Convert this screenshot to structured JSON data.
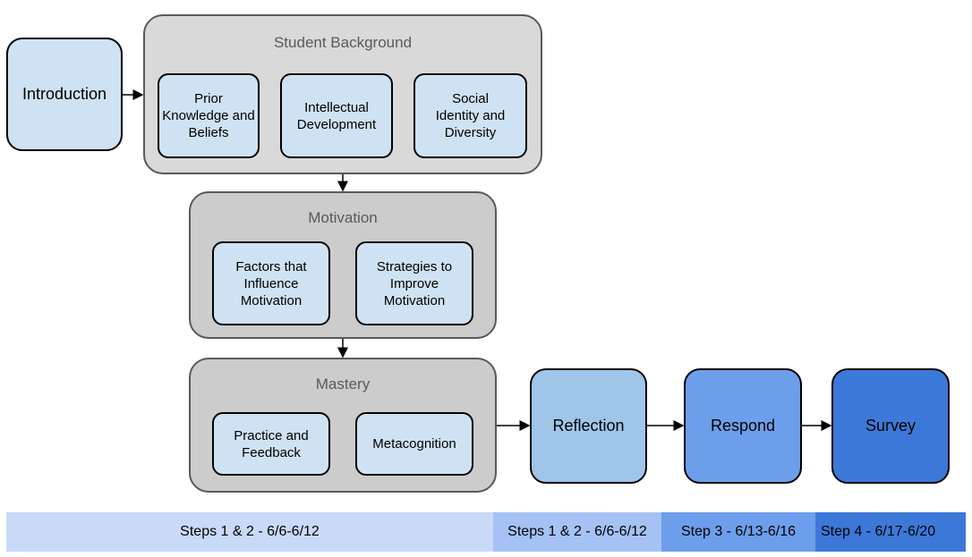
{
  "nodes": {
    "introduction": "Introduction",
    "reflection": "Reflection",
    "respond": "Respond",
    "survey": "Survey"
  },
  "groups": {
    "background": {
      "title": "Student Background",
      "items": [
        "Prior Knowledge and Beliefs",
        "Intellectual Development",
        "Social Identity and Diversity"
      ]
    },
    "motivation": {
      "title": "Motivation",
      "items": [
        "Factors that Influence Motivation",
        "Strategies to Improve Motivation"
      ]
    },
    "mastery": {
      "title": "Mastery",
      "items": [
        "Practice and Feedback",
        "Metacognition"
      ]
    }
  },
  "timeline": [
    "Steps 1 & 2 - 6/6-6/12",
    "Steps 1 & 2 - 6/6-6/12",
    "Step 3 - 6/13-6/16",
    "Step 4 - 6/17-6/20"
  ],
  "colors": {
    "inner": "#cfe2f3",
    "reflection": "#9fc5e8",
    "respond": "#6d9eeb",
    "survey": "#3c78d8",
    "group_bg": "#d9d9d9",
    "group_bg2": "#cccccc",
    "bar1": "#c9daf8",
    "bar2": "#a4c2f4",
    "bar3": "#6d9eeb",
    "bar4": "#3c78d8"
  }
}
